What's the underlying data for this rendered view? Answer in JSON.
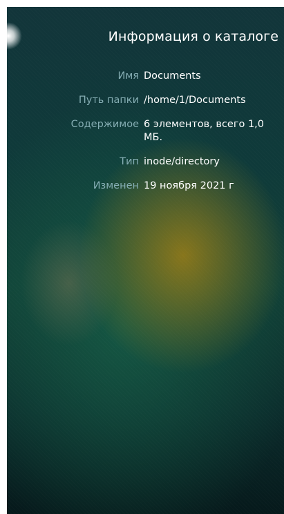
{
  "dialog": {
    "title": "Информация о каталоге"
  },
  "properties": [
    {
      "label": "Имя",
      "value": "Documents"
    },
    {
      "label": "Путь папки",
      "value": "/home/1/Documents"
    },
    {
      "label": "Содержимое",
      "value": "6 элементов, всего 1,0 МБ."
    },
    {
      "label": "Тип",
      "value": "inode/directory"
    },
    {
      "label": "Изменен",
      "value": "19 ноября 2021 г"
    }
  ]
}
